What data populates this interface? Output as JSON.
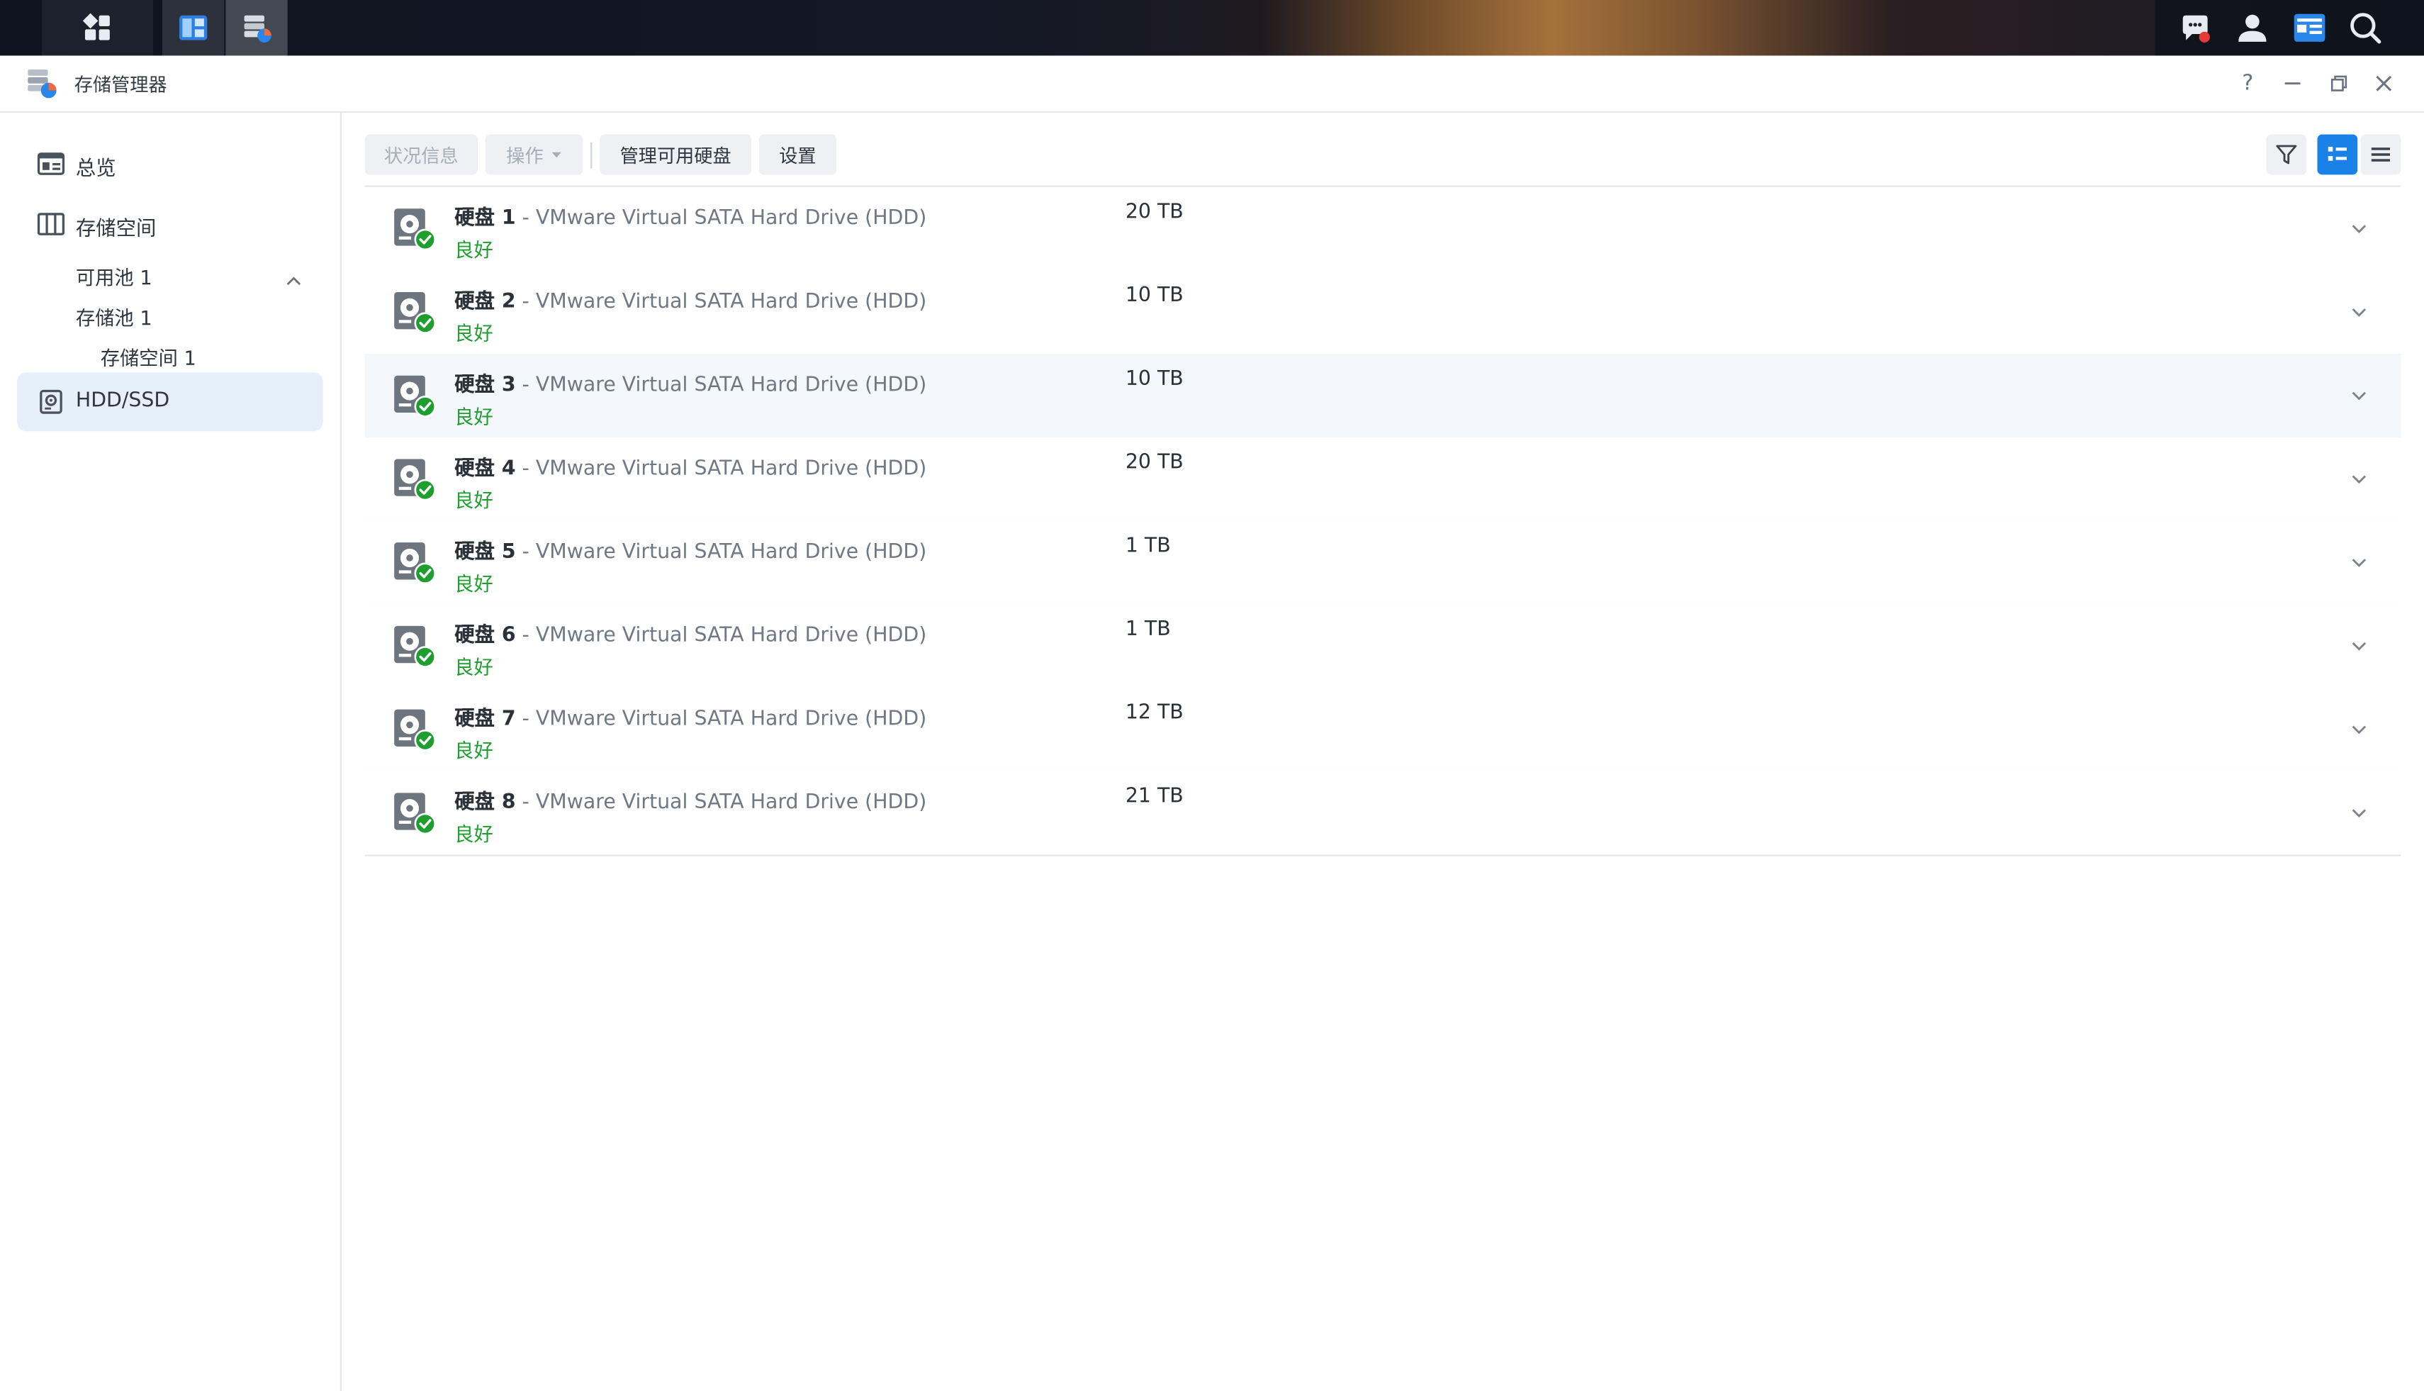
{
  "window": {
    "title": "存储管理器",
    "controls": [
      "help",
      "minimize",
      "restore",
      "close"
    ],
    "help_label": "?"
  },
  "sidebar": {
    "overview": "总览",
    "storage": "存储空间",
    "sub_items": [
      "可用池 1",
      "存储池 1",
      "存储空间 1"
    ],
    "hdd": "HDD/SSD"
  },
  "toolbar": {
    "status_info": "状况信息",
    "action": "操作",
    "manage_disks": "管理可用硬盘",
    "settings": "设置"
  },
  "disks": [
    {
      "label": "硬盘",
      "num": "1",
      "model": " - VMware Virtual SATA Hard Drive (HDD)",
      "status": "良好",
      "size": "20 TB"
    },
    {
      "label": "硬盘",
      "num": "2",
      "model": " - VMware Virtual SATA Hard Drive (HDD)",
      "status": "良好",
      "size": "10 TB"
    },
    {
      "label": "硬盘",
      "num": "3",
      "model": " - VMware Virtual SATA Hard Drive (HDD)",
      "status": "良好",
      "size": "10 TB"
    },
    {
      "label": "硬盘",
      "num": "4",
      "model": " - VMware Virtual SATA Hard Drive (HDD)",
      "status": "良好",
      "size": "20 TB"
    },
    {
      "label": "硬盘",
      "num": "5",
      "model": " - VMware Virtual SATA Hard Drive (HDD)",
      "status": "良好",
      "size": "1 TB"
    },
    {
      "label": "硬盘",
      "num": "6",
      "model": " - VMware Virtual SATA Hard Drive (HDD)",
      "status": "良好",
      "size": "1 TB"
    },
    {
      "label": "硬盘",
      "num": "7",
      "model": " - VMware Virtual SATA Hard Drive (HDD)",
      "status": "良好",
      "size": "12 TB"
    },
    {
      "label": "硬盘",
      "num": "8",
      "model": " - VMware Virtual SATA Hard Drive (HDD)",
      "status": "良好",
      "size": "21 TB"
    }
  ],
  "colors": {
    "accent": "#1a82e6",
    "ok_green": "#1e9e2f",
    "notification_red": "#e53935"
  },
  "icons": [
    "grid-icon",
    "taskbar-app-icon",
    "storage-manager-icon",
    "chat-icon",
    "user-icon",
    "widget-icon",
    "search-icon",
    "filter-icon",
    "card-view-icon",
    "list-view-icon",
    "disk-icon",
    "chevron-down-icon"
  ]
}
